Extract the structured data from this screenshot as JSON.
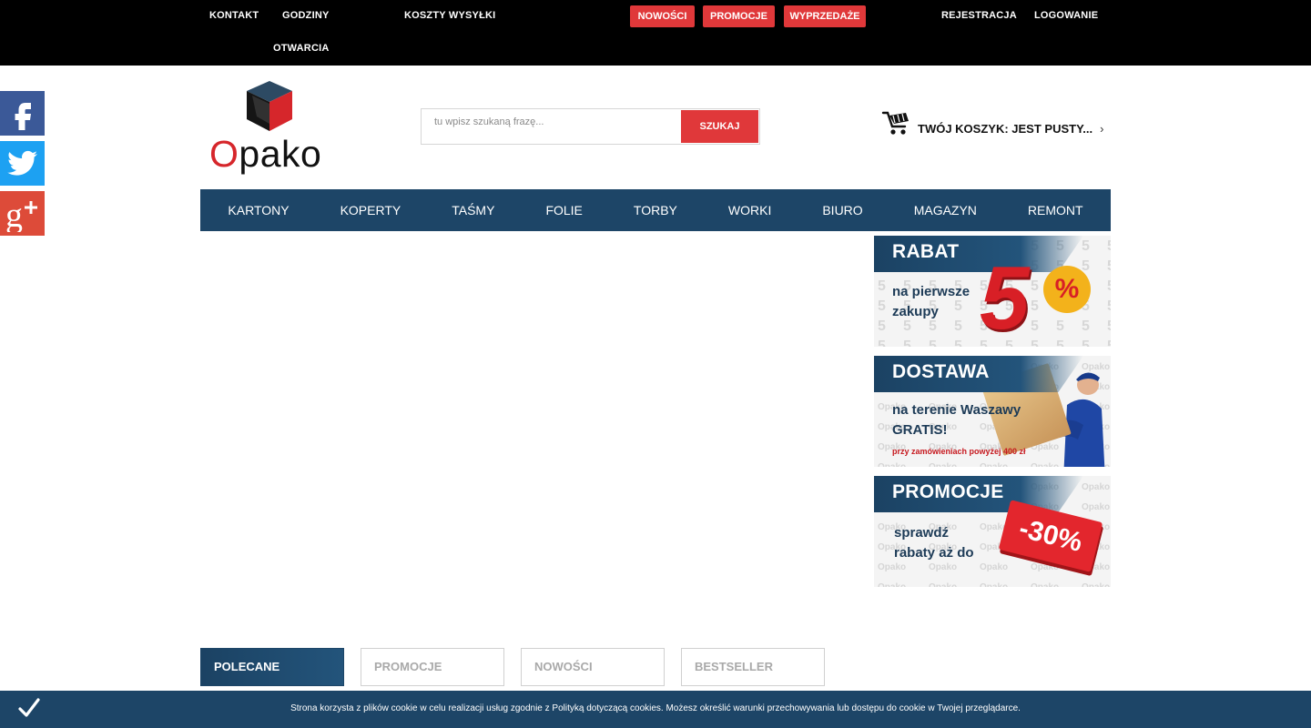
{
  "topbar": {
    "links": {
      "kontakt": "KONTAKT",
      "godziny_line1": "GODZINY",
      "godziny_line2": "OTWARCIA",
      "koszty": "KOSZTY WYSYŁKI",
      "rejestracja": "REJESTRACJA",
      "logowanie": "LOGOWANIE"
    },
    "pills": {
      "nowosci": "NOWOŚCI",
      "promocje": "PROMOCJE",
      "wyprzedaze": "WYPRZEDAŻE"
    }
  },
  "social": [
    "facebook-icon",
    "twitter-icon",
    "google-plus-icon"
  ],
  "logo": {
    "first_letter": "O",
    "rest": "pako"
  },
  "search": {
    "placeholder": "tu wpisz szukaną frazę...",
    "button": "SZUKAJ"
  },
  "cart": {
    "label": "TWÓJ KOSZYK: JEST PUSTY...",
    "icon": "cart-icon"
  },
  "nav": [
    "KARTONY",
    "KOPERTY",
    "TAŚMY",
    "FOLIE",
    "TORBY",
    "WORKI",
    "BIURO",
    "MAGAZYN",
    "REMONT"
  ],
  "banners": {
    "rabat": {
      "title": "RABAT",
      "line1": "na pierwsze",
      "line2": "zakupy",
      "big": "5",
      "pct": "%"
    },
    "dostawa": {
      "title": "DOSTAWA",
      "line1": "na terenie Waszawy",
      "line2": "GRATIS!",
      "note": "przy zamówieniach powyżej 400 zł"
    },
    "promocje": {
      "title": "PROMOCJE",
      "line1": "sprawdź",
      "line2": "rabaty  aż do",
      "tag": "-30%"
    }
  },
  "tabs": [
    "POLECANE",
    "PROMOCJE",
    "NOWOŚCI",
    "BESTSELLER"
  ],
  "cookie": {
    "text": "Strona korzysta z plików cookie w celu realizacji usług zgodnie z Polityką dotyczącą cookies. Możesz określić warunki przechowywania lub dostępu do cookie w Twojej przeglądarce."
  },
  "colors": {
    "accent_red": "#e0383a",
    "brand_blue": "#1d4567"
  }
}
